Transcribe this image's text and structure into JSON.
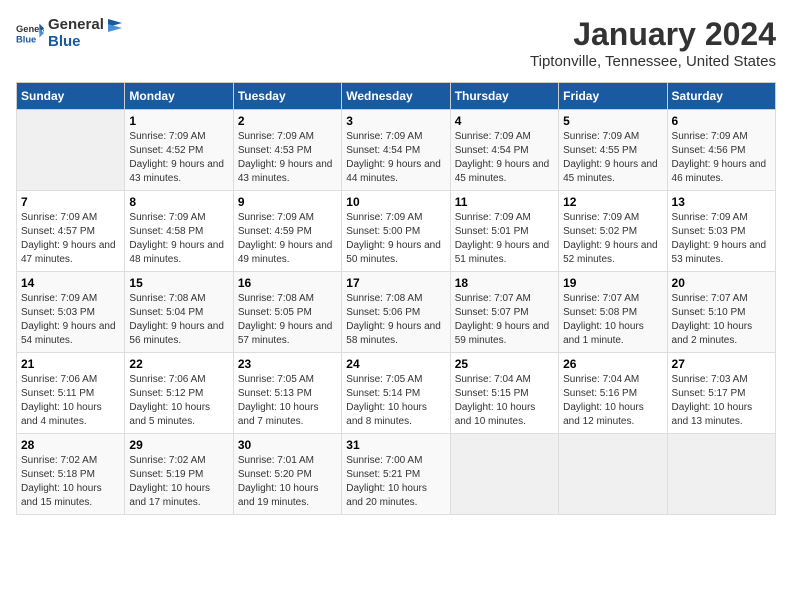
{
  "header": {
    "logo_general": "General",
    "logo_blue": "Blue",
    "title": "January 2024",
    "subtitle": "Tiptonville, Tennessee, United States"
  },
  "weekdays": [
    "Sunday",
    "Monday",
    "Tuesday",
    "Wednesday",
    "Thursday",
    "Friday",
    "Saturday"
  ],
  "weeks": [
    [
      {
        "day": "",
        "empty": true
      },
      {
        "day": "1",
        "sunrise": "7:09 AM",
        "sunset": "4:52 PM",
        "daylight": "9 hours and 43 minutes."
      },
      {
        "day": "2",
        "sunrise": "7:09 AM",
        "sunset": "4:53 PM",
        "daylight": "9 hours and 43 minutes."
      },
      {
        "day": "3",
        "sunrise": "7:09 AM",
        "sunset": "4:54 PM",
        "daylight": "9 hours and 44 minutes."
      },
      {
        "day": "4",
        "sunrise": "7:09 AM",
        "sunset": "4:54 PM",
        "daylight": "9 hours and 45 minutes."
      },
      {
        "day": "5",
        "sunrise": "7:09 AM",
        "sunset": "4:55 PM",
        "daylight": "9 hours and 45 minutes."
      },
      {
        "day": "6",
        "sunrise": "7:09 AM",
        "sunset": "4:56 PM",
        "daylight": "9 hours and 46 minutes."
      }
    ],
    [
      {
        "day": "7",
        "sunrise": "7:09 AM",
        "sunset": "4:57 PM",
        "daylight": "9 hours and 47 minutes."
      },
      {
        "day": "8",
        "sunrise": "7:09 AM",
        "sunset": "4:58 PM",
        "daylight": "9 hours and 48 minutes."
      },
      {
        "day": "9",
        "sunrise": "7:09 AM",
        "sunset": "4:59 PM",
        "daylight": "9 hours and 49 minutes."
      },
      {
        "day": "10",
        "sunrise": "7:09 AM",
        "sunset": "5:00 PM",
        "daylight": "9 hours and 50 minutes."
      },
      {
        "day": "11",
        "sunrise": "7:09 AM",
        "sunset": "5:01 PM",
        "daylight": "9 hours and 51 minutes."
      },
      {
        "day": "12",
        "sunrise": "7:09 AM",
        "sunset": "5:02 PM",
        "daylight": "9 hours and 52 minutes."
      },
      {
        "day": "13",
        "sunrise": "7:09 AM",
        "sunset": "5:03 PM",
        "daylight": "9 hours and 53 minutes."
      }
    ],
    [
      {
        "day": "14",
        "sunrise": "7:09 AM",
        "sunset": "5:03 PM",
        "daylight": "9 hours and 54 minutes."
      },
      {
        "day": "15",
        "sunrise": "7:08 AM",
        "sunset": "5:04 PM",
        "daylight": "9 hours and 56 minutes."
      },
      {
        "day": "16",
        "sunrise": "7:08 AM",
        "sunset": "5:05 PM",
        "daylight": "9 hours and 57 minutes."
      },
      {
        "day": "17",
        "sunrise": "7:08 AM",
        "sunset": "5:06 PM",
        "daylight": "9 hours and 58 minutes."
      },
      {
        "day": "18",
        "sunrise": "7:07 AM",
        "sunset": "5:07 PM",
        "daylight": "9 hours and 59 minutes."
      },
      {
        "day": "19",
        "sunrise": "7:07 AM",
        "sunset": "5:08 PM",
        "daylight": "10 hours and 1 minute."
      },
      {
        "day": "20",
        "sunrise": "7:07 AM",
        "sunset": "5:10 PM",
        "daylight": "10 hours and 2 minutes."
      }
    ],
    [
      {
        "day": "21",
        "sunrise": "7:06 AM",
        "sunset": "5:11 PM",
        "daylight": "10 hours and 4 minutes."
      },
      {
        "day": "22",
        "sunrise": "7:06 AM",
        "sunset": "5:12 PM",
        "daylight": "10 hours and 5 minutes."
      },
      {
        "day": "23",
        "sunrise": "7:05 AM",
        "sunset": "5:13 PM",
        "daylight": "10 hours and 7 minutes."
      },
      {
        "day": "24",
        "sunrise": "7:05 AM",
        "sunset": "5:14 PM",
        "daylight": "10 hours and 8 minutes."
      },
      {
        "day": "25",
        "sunrise": "7:04 AM",
        "sunset": "5:15 PM",
        "daylight": "10 hours and 10 minutes."
      },
      {
        "day": "26",
        "sunrise": "7:04 AM",
        "sunset": "5:16 PM",
        "daylight": "10 hours and 12 minutes."
      },
      {
        "day": "27",
        "sunrise": "7:03 AM",
        "sunset": "5:17 PM",
        "daylight": "10 hours and 13 minutes."
      }
    ],
    [
      {
        "day": "28",
        "sunrise": "7:02 AM",
        "sunset": "5:18 PM",
        "daylight": "10 hours and 15 minutes."
      },
      {
        "day": "29",
        "sunrise": "7:02 AM",
        "sunset": "5:19 PM",
        "daylight": "10 hours and 17 minutes."
      },
      {
        "day": "30",
        "sunrise": "7:01 AM",
        "sunset": "5:20 PM",
        "daylight": "10 hours and 19 minutes."
      },
      {
        "day": "31",
        "sunrise": "7:00 AM",
        "sunset": "5:21 PM",
        "daylight": "10 hours and 20 minutes."
      },
      {
        "day": "",
        "empty": true
      },
      {
        "day": "",
        "empty": true
      },
      {
        "day": "",
        "empty": true
      }
    ]
  ]
}
